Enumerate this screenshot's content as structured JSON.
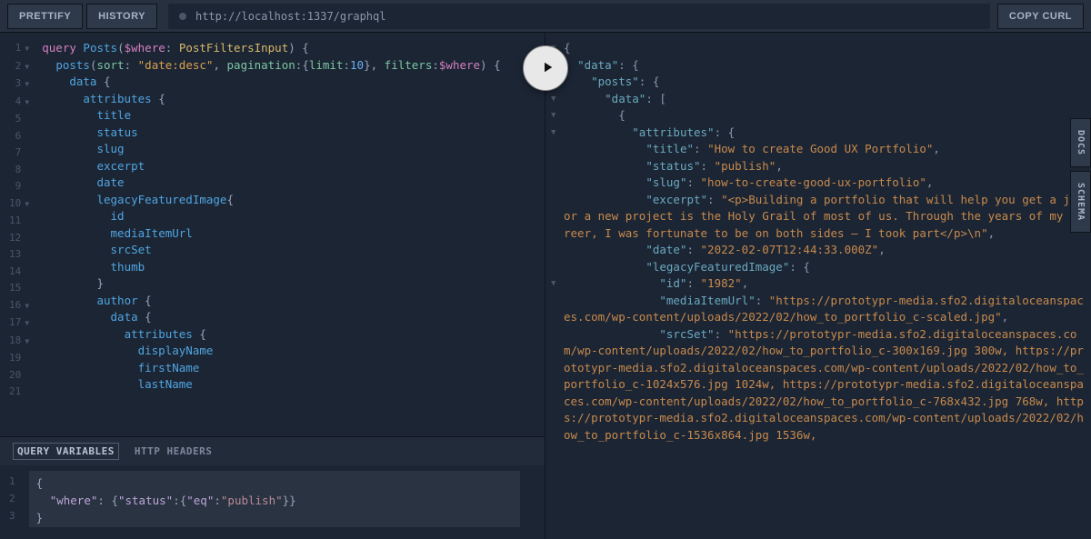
{
  "toolbar": {
    "prettify": "PRETTIFY",
    "history": "HISTORY",
    "copyCurl": "COPY CURL",
    "url": "http://localhost:1337/graphql"
  },
  "sideTabs": {
    "docs": "DOCS",
    "schema": "SCHEMA"
  },
  "bottomTabs": {
    "queryVars": "QUERY VARIABLES",
    "httpHeaders": "HTTP HEADERS"
  },
  "query": {
    "lines": [
      {
        "n": 1,
        "fold": true,
        "html": "<span class='kw'>query</span> <span class='field'>Posts</span><span class='punct'>(</span><span class='var'>$where</span><span class='punct'>:</span> <span class='type'>PostFiltersInput</span><span class='punct'>)</span> <span class='brace'>{</span>"
      },
      {
        "n": 2,
        "fold": true,
        "html": "  <span class='field'>posts</span><span class='punct'>(</span><span class='attr'>sort</span><span class='punct'>:</span> <span class='str'>\"date:desc\"</span><span class='punct'>,</span> <span class='attr'>pagination</span><span class='punct'>:</span><span class='brace'>{</span><span class='attr'>limit</span><span class='punct'>:</span><span class='num'>10</span><span class='brace'>}</span><span class='punct'>,</span> <span class='attr'>filters</span><span class='punct'>:</span><span class='var'>$where</span><span class='punct'>)</span> <span class='brace'>{</span>"
      },
      {
        "n": 3,
        "fold": true,
        "html": "    <span class='field'>data</span> <span class='brace'>{</span>"
      },
      {
        "n": 4,
        "fold": true,
        "html": "      <span class='field'>attributes</span> <span class='brace'>{</span>"
      },
      {
        "n": 5,
        "fold": false,
        "html": "        <span class='field'>title</span>"
      },
      {
        "n": 6,
        "fold": false,
        "html": "        <span class='field'>status</span>"
      },
      {
        "n": 7,
        "fold": false,
        "html": "        <span class='field'>slug</span>"
      },
      {
        "n": 8,
        "fold": false,
        "html": "        <span class='field'>excerpt</span>"
      },
      {
        "n": 9,
        "fold": false,
        "html": "        <span class='field'>date</span>"
      },
      {
        "n": 10,
        "fold": true,
        "html": "        <span class='field'>legacyFeaturedImage</span><span class='brace'>{</span>"
      },
      {
        "n": 11,
        "fold": false,
        "html": "          <span class='field'>id</span>"
      },
      {
        "n": 12,
        "fold": false,
        "html": "          <span class='field'>mediaItemUrl</span>"
      },
      {
        "n": 13,
        "fold": false,
        "html": "          <span class='field'>srcSet</span>"
      },
      {
        "n": 14,
        "fold": false,
        "html": "          <span class='field'>thumb</span>"
      },
      {
        "n": 15,
        "fold": false,
        "html": "        <span class='brace'>}</span>"
      },
      {
        "n": 16,
        "fold": true,
        "html": "        <span class='field'>author</span> <span class='brace'>{</span>"
      },
      {
        "n": 17,
        "fold": true,
        "html": "          <span class='field'>data</span> <span class='brace'>{</span>"
      },
      {
        "n": 18,
        "fold": true,
        "html": "            <span class='field'>attributes</span> <span class='brace'>{</span>"
      },
      {
        "n": 19,
        "fold": false,
        "html": "              <span class='field'>displayName</span>"
      },
      {
        "n": 20,
        "fold": false,
        "html": "              <span class='field'>firstName</span>"
      },
      {
        "n": 21,
        "fold": false,
        "html": "              <span class='field'>lastName</span>"
      }
    ]
  },
  "variables": {
    "lines": [
      {
        "n": 1,
        "html": "<span class='brace'>{</span>"
      },
      {
        "n": 2,
        "html": "  <span class='jkey'>\"where\"</span><span class='punct'>:</span> <span class='brace'>{</span><span class='jkey'>\"status\"</span><span class='punct'>:</span><span class='brace'>{</span><span class='jkey'>\"eq\"</span><span class='punct'>:</span><span class='jstr'>\"publish\"</span><span class='brace'>}}</span>"
      },
      {
        "n": 3,
        "html": "<span class='brace'>}</span>"
      }
    ]
  },
  "result": {
    "html": "{\n  <span class='rk'>\"data\"</span>: {\n    <span class='rk'>\"posts\"</span>: {\n      <span class='rk'>\"data\"</span>: [\n        {\n          <span class='rk'>\"attributes\"</span>: {\n            <span class='rk'>\"title\"</span>: <span class='rs'>\"How to create Good UX Portfolio\"</span>,\n            <span class='rk'>\"status\"</span>: <span class='rs'>\"publish\"</span>,\n            <span class='rk'>\"slug\"</span>: <span class='rs'>\"how-to-create-good-ux-portfolio\"</span>,\n            <span class='rk'>\"excerpt\"</span>: <span class='rs'>\"&lt;p&gt;Building a portfolio that will help you get a job or a new project is the Holy Grail of most of us. Through the years of my career, I was fortunate to be on both sides – I took part&lt;/p&gt;\\n\"</span>,\n            <span class='rk'>\"date\"</span>: <span class='rs'>\"2022-02-07T12:44:33.000Z\"</span>,\n            <span class='rk'>\"legacyFeaturedImage\"</span>: {\n              <span class='rk'>\"id\"</span>: <span class='rs'>\"1982\"</span>,\n              <span class='rk'>\"mediaItemUrl\"</span>: <span class='rs'>\"https://prototypr-media.sfo2.digitaloceanspaces.com/wp-content/uploads/2022/02/how_to_portfolio_c-scaled.jpg\"</span>,\n              <span class='rk'>\"srcSet\"</span>: <span class='rs'>\"https://prototypr-media.sfo2.digitaloceanspaces.com/wp-content/uploads/2022/02/how_to_portfolio_c-300x169.jpg 300w, https://prototypr-media.sfo2.digitaloceanspaces.com/wp-content/uploads/2022/02/how_to_portfolio_c-1024x576.jpg 1024w, https://prototypr-media.sfo2.digitaloceanspaces.com/wp-content/uploads/2022/02/how_to_portfolio_c-768x432.jpg 768w, https://prototypr-media.sfo2.digitaloceanspaces.com/wp-content/uploads/2022/02/how_to_portfolio_c-1536x864.jpg 1536w,</span>"
  },
  "resultFold": [
    true,
    true,
    true,
    true,
    true,
    true,
    false,
    false,
    false,
    false,
    false,
    false,
    false,
    false,
    true,
    false,
    false,
    false,
    false,
    false,
    false,
    false,
    false,
    false,
    false,
    false,
    false,
    false,
    false
  ]
}
